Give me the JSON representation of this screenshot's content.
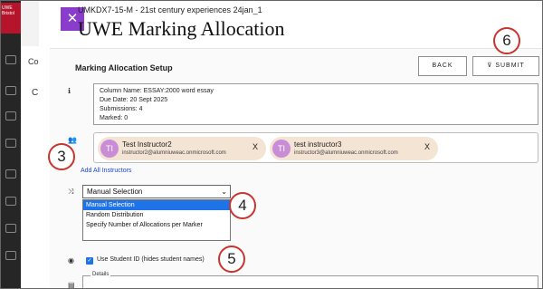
{
  "background_app": {
    "logo_text": "UWE Bristol",
    "side_tab_1": "Co",
    "side_tab_2": "C"
  },
  "modal": {
    "course_title": "UMKDX7-15-M - 21st century experiences 24jan_1",
    "page_title": "UWE Marking Allocation",
    "setup_label": "Marking Allocation Setup",
    "back_label": "BACK",
    "submit_label": "SUBMIT",
    "submit_icon": "send-icon"
  },
  "column_info": {
    "column_name": "Column Name:   ESSAY:2000 word essay",
    "due_date": "Due Date:   20 Sept 2025",
    "submissions": "Submissions:   4",
    "marked": "Marked:   0"
  },
  "instructors": [
    {
      "initials": "TI",
      "name": "Test Instructor2",
      "email": "instructor2@alumniuweac.onmicrosoft.com",
      "remove": "X"
    },
    {
      "initials": "TI",
      "name": "test instructor3",
      "email": "instructor3@alumniuweac.onmicrosoft.com",
      "remove": "X"
    }
  ],
  "add_all_label": "Add All Instructors",
  "allocation_select": {
    "value": "Manual Selection",
    "options": [
      "Manual Selection",
      "Random Distribution",
      "Specify Number of Allocations per Marker"
    ]
  },
  "use_student_id": {
    "checked": true,
    "label": "Use Student ID (hides student names)"
  },
  "details_label": "Details",
  "callouts": [
    "3",
    "4",
    "5",
    "6"
  ],
  "colors": {
    "accent": "#8a3ccc",
    "link": "#1a47d4",
    "selected": "#1f73e8",
    "callout": "#c8352d",
    "chip": "#f3e4d4"
  }
}
